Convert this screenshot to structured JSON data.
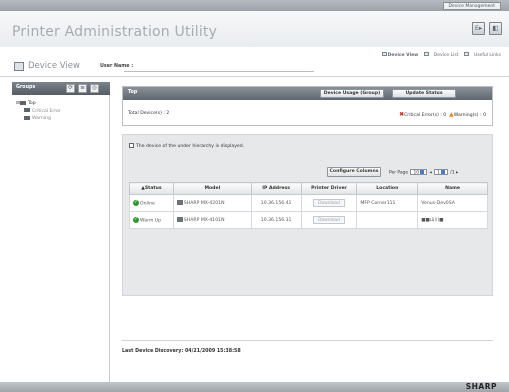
{
  "top_link": "Device Management",
  "app_title": "Printer Administration Utility",
  "header_buttons": {
    "export": "E▸",
    "help": "◧"
  },
  "view": {
    "title": "Device View",
    "user_label": "User Name :"
  },
  "view_links": [
    "Device View",
    "Device List",
    "Useful Links"
  ],
  "sidebar": {
    "groups_label": "Groups",
    "tree": [
      "Top",
      "Critical Error",
      "Warning"
    ]
  },
  "top_panel": {
    "title": "Top",
    "usage_btn": "Device Usage (Group)",
    "update_btn": "Update Status",
    "total": "Total Device(s) : 2",
    "critical": "Critical Error(s) : 0",
    "warning": "Warning(s) : 0"
  },
  "list": {
    "checkbox_label": "The device of the under hierarchy is displayed.",
    "config_btn": "Configure Columns",
    "per_page_label": "Per Page",
    "per_page_value": "10",
    "page_value": "1",
    "page_suffix": "/1",
    "columns": [
      "▲Status",
      "Model",
      "IP Address",
      "Printer Driver",
      "Location",
      "Name"
    ],
    "rows": [
      {
        "status": "Online",
        "model": "SHARP MX-4201N",
        "ip": "10.36.156.41",
        "driver": "Download",
        "location": "MFP Corner111",
        "name": "Venus-Dev0SA"
      },
      {
        "status": "Warm Up",
        "model": "SHARP MX-4101N",
        "ip": "10.36.156.31",
        "driver": "Download",
        "location": "",
        "name": "■■山川■"
      }
    ]
  },
  "last_discovery": "Last Device Discovery: 04/21/2009 15:38:58",
  "brand": "SHARP",
  "colors": {
    "ok": "#2e9a2e",
    "critical": "#d0281e",
    "warning": "#e58a12"
  }
}
